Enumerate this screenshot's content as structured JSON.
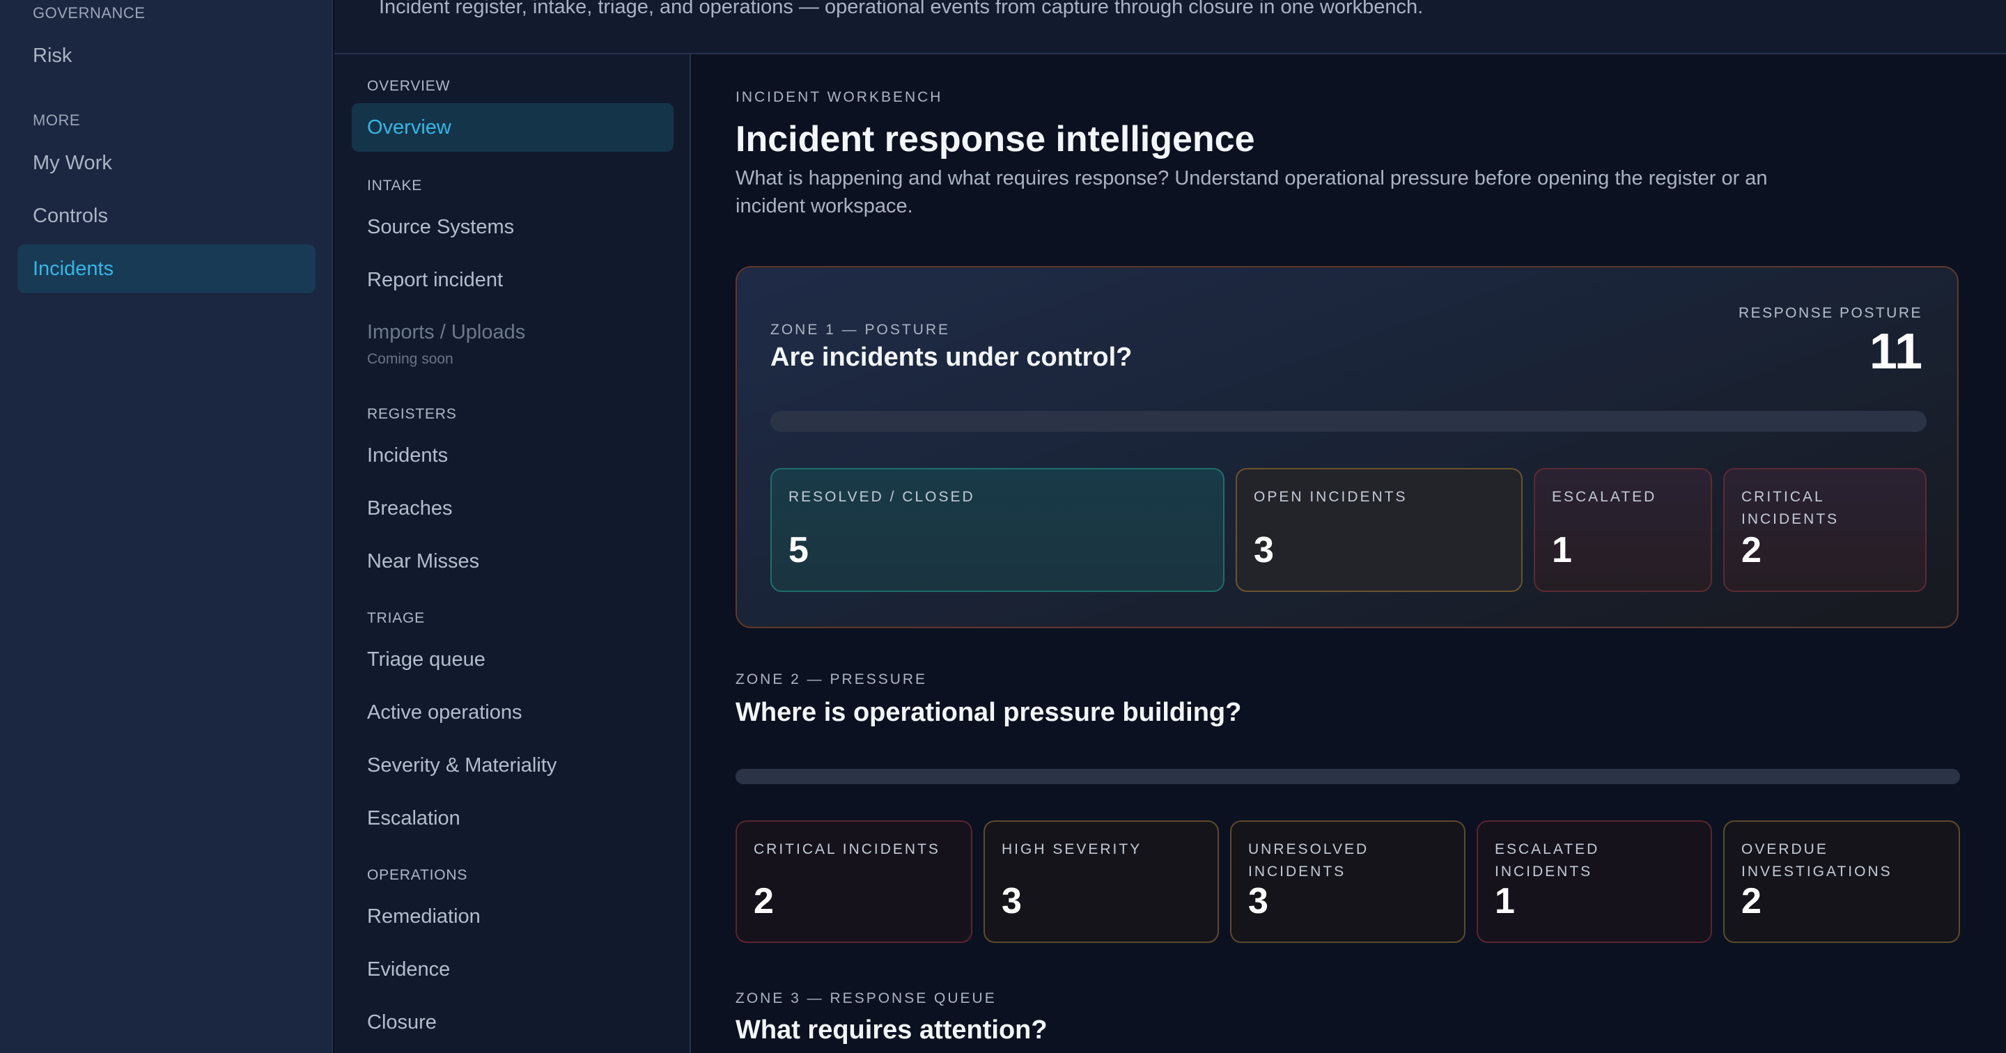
{
  "app_sidebar": {
    "sections": [
      {
        "label": "GOVERNANCE",
        "items": [
          {
            "label": "Risk"
          }
        ]
      },
      {
        "label": "MORE",
        "items": [
          {
            "label": "My Work"
          },
          {
            "label": "Controls"
          },
          {
            "label": "Incidents",
            "active": true
          }
        ]
      }
    ]
  },
  "header": {
    "subtitle": "Incident register, intake, triage, and operations — operational events from capture through closure in one workbench."
  },
  "sub_sidebar": {
    "overview": {
      "label": "OVERVIEW",
      "item": "Overview"
    },
    "intake": {
      "label": "INTAKE",
      "items": [
        "Source Systems",
        "Report incident",
        "Imports / Uploads"
      ],
      "coming_soon": "Coming soon"
    },
    "registers": {
      "label": "REGISTERS",
      "items": [
        "Incidents",
        "Breaches",
        "Near Misses"
      ]
    },
    "triage": {
      "label": "TRIAGE",
      "items": [
        "Triage queue",
        "Active operations",
        "Severity & Materiality",
        "Escalation"
      ]
    },
    "operations": {
      "label": "OPERATIONS",
      "items": [
        "Remediation",
        "Evidence",
        "Closure"
      ]
    }
  },
  "main": {
    "eyebrow": "INCIDENT WORKBENCH",
    "title": "Incident response intelligence",
    "description": "What is happening and what requires response? Understand operational pressure before opening the register or an incident workspace.",
    "zone1": {
      "eyebrow": "ZONE 1 — POSTURE",
      "question": "Are incidents under control?",
      "posture_label": "RESPONSE POSTURE",
      "posture_value": "11",
      "progress_fraction": 0,
      "stats": [
        {
          "label": "RESOLVED / CLOSED",
          "value": "5",
          "tone": "teal"
        },
        {
          "label": "OPEN INCIDENTS",
          "value": "3",
          "tone": "amber"
        },
        {
          "label": "ESCALATED",
          "value": "1",
          "tone": "red"
        },
        {
          "label": "CRITICAL INCIDENTS",
          "value": "2",
          "tone": "red"
        }
      ]
    },
    "zone2": {
      "eyebrow": "ZONE 2 — PRESSURE",
      "question": "Where is operational pressure building?",
      "progress_fraction": 0,
      "stats": [
        {
          "label": "CRITICAL INCIDENTS",
          "value": "2",
          "tone": "red-dark"
        },
        {
          "label": "HIGH SEVERITY",
          "value": "3",
          "tone": "amber-dark"
        },
        {
          "label": "UNRESOLVED INCIDENTS",
          "value": "3",
          "tone": "amber-dark"
        },
        {
          "label": "ESCALATED INCIDENTS",
          "value": "1",
          "tone": "red-dark"
        },
        {
          "label": "OVERDUE INVESTIGATIONS",
          "value": "2",
          "tone": "amber-dark"
        }
      ]
    },
    "zone3": {
      "eyebrow": "ZONE 3 — RESPONSE QUEUE",
      "question": "What requires attention?"
    }
  }
}
